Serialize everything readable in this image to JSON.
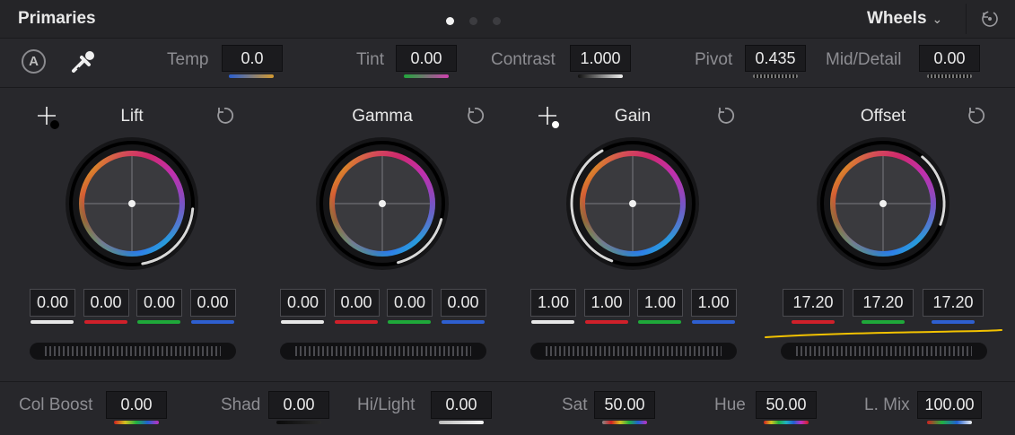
{
  "header": {
    "title": "Primaries",
    "mode": "Wheels",
    "pages": 3,
    "active_page": 1
  },
  "top_params": [
    {
      "label": "Temp",
      "value": "0.0"
    },
    {
      "label": "Tint",
      "value": "0.00"
    },
    {
      "label": "Contrast",
      "value": "1.000"
    },
    {
      "label": "Pivot",
      "value": "0.435"
    },
    {
      "label": "Mid/Detail",
      "value": "0.00"
    }
  ],
  "wheels": [
    {
      "name": "Lift",
      "values": [
        "0.00",
        "0.00",
        "0.00",
        "0.00"
      ],
      "has_picker": true
    },
    {
      "name": "Gamma",
      "values": [
        "0.00",
        "0.00",
        "0.00",
        "0.00"
      ],
      "has_picker": false
    },
    {
      "name": "Gain",
      "values": [
        "1.00",
        "1.00",
        "1.00",
        "1.00"
      ],
      "has_picker": true
    },
    {
      "name": "Offset",
      "values": [
        "17.20",
        "17.20",
        "17.20"
      ],
      "has_picker": false
    }
  ],
  "bottom_params": [
    {
      "label": "Col Boost",
      "value": "0.00"
    },
    {
      "label": "Shad",
      "value": "0.00"
    },
    {
      "label": "Hi/Light",
      "value": "0.00"
    },
    {
      "label": "Sat",
      "value": "50.00"
    },
    {
      "label": "Hue",
      "value": "50.00"
    },
    {
      "label": "L. Mix",
      "value": "100.00"
    }
  ],
  "colors": {
    "white": "#e8e8e8",
    "red": "#d0202a",
    "green": "#1fa83a",
    "blue": "#2e5fd0",
    "annotation": "#f2c200"
  }
}
